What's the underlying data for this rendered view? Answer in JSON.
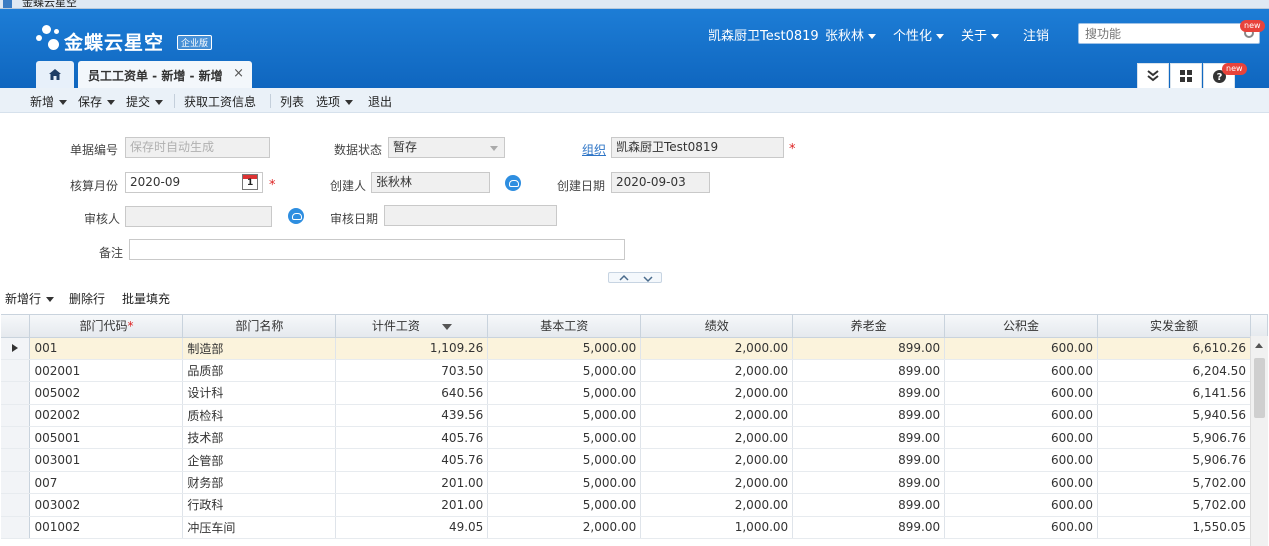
{
  "window": {
    "title": "金蝶云星空"
  },
  "header": {
    "brand": "金蝶云星空",
    "edition_badge": "企业版",
    "org_menu": "凯森厨卫Test0819",
    "user_menu": "张秋林",
    "personalize_menu": "个性化",
    "about_menu": "关于",
    "logout": "注销",
    "search_placeholder": "搜功能",
    "new_badge": "new"
  },
  "tabs": {
    "home_icon": "home-icon",
    "active_label": "员工工资单 - 新增 - 新增",
    "close": "×"
  },
  "toolbar": {
    "new": "新增",
    "save": "保存",
    "submit": "提交",
    "fetch_salary": "获取工资信息",
    "list": "列表",
    "options": "选项",
    "exit": "退出"
  },
  "form": {
    "bill_no_label": "单据编号",
    "bill_no_placeholder": "保存时自动生成",
    "status_label": "数据状态",
    "status_value": "暂存",
    "org_label": "组织",
    "org_value": "凯森厨卫Test0819",
    "period_label": "核算月份",
    "period_value": "2020-09",
    "calendar_day": "1",
    "creator_label": "创建人",
    "creator_value": "张秋林",
    "create_date_label": "创建日期",
    "create_date_value": "2020-09-03",
    "auditor_label": "审核人",
    "auditor_value": "",
    "audit_date_label": "审核日期",
    "audit_date_value": "",
    "remark_label": "备注",
    "remark_value": "",
    "required_mark": "*"
  },
  "grid_toolbar": {
    "add_row": "新增行",
    "delete_row": "删除行",
    "batch_fill": "批量填充"
  },
  "grid": {
    "columns": [
      "部门代码",
      "部门名称",
      "计件工资",
      "基本工资",
      "绩效",
      "养老金",
      "公积金",
      "实发金额"
    ],
    "rows": [
      [
        "001",
        "制造部",
        "1,109.26",
        "5,000.00",
        "2,000.00",
        "899.00",
        "600.00",
        "6,610.26"
      ],
      [
        "002001",
        "品质部",
        "703.50",
        "5,000.00",
        "2,000.00",
        "899.00",
        "600.00",
        "6,204.50"
      ],
      [
        "005002",
        "设计科",
        "640.56",
        "5,000.00",
        "2,000.00",
        "899.00",
        "600.00",
        "6,141.56"
      ],
      [
        "002002",
        "质检科",
        "439.56",
        "5,000.00",
        "2,000.00",
        "899.00",
        "600.00",
        "5,940.56"
      ],
      [
        "005001",
        "技术部",
        "405.76",
        "5,000.00",
        "2,000.00",
        "899.00",
        "600.00",
        "5,906.76"
      ],
      [
        "003001",
        "企管部",
        "405.76",
        "5,000.00",
        "2,000.00",
        "899.00",
        "600.00",
        "5,906.76"
      ],
      [
        "007",
        "财务部",
        "201.00",
        "5,000.00",
        "2,000.00",
        "899.00",
        "600.00",
        "5,702.00"
      ],
      [
        "003002",
        "行政科",
        "201.00",
        "5,000.00",
        "2,000.00",
        "899.00",
        "600.00",
        "5,702.00"
      ],
      [
        "001002",
        "冲压车间",
        "49.05",
        "2,000.00",
        "1,000.00",
        "899.00",
        "600.00",
        "1,550.05"
      ]
    ]
  }
}
